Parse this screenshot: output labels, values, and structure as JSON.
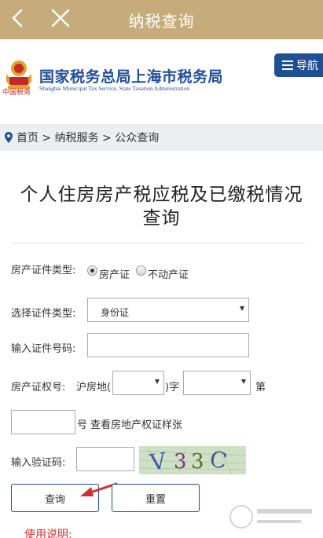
{
  "topbar": {
    "title": "纳税查询",
    "back_icon": "chevron-left-icon",
    "close_icon": "close-icon",
    "background": "#c6ac7a"
  },
  "header": {
    "bureau_name": "国家税务总局上海市税务局",
    "bureau_name_en": "Shanghai Municipal Tax Service, State Taxation Administration",
    "emblem_caption": "中国税务",
    "nav_label": "导航",
    "nav_icon": "menu-icon",
    "brand_color": "#1f4e9c"
  },
  "breadcrumb": {
    "icon": "location-pin-icon",
    "text": "首页 > 纳税服务 > 公众查询"
  },
  "page": {
    "title_line1": "个人住房房产税应税及已缴税情况",
    "title_line2": "查询"
  },
  "form": {
    "cert_type_label": "房产证件类型:",
    "cert_type_options": [
      "房产证",
      "不动产证"
    ],
    "cert_type_selected": "房产证",
    "id_type_label": "选择证件类型:",
    "id_type_value": "身份证",
    "id_number_label": "输入证件号码:",
    "id_number_value": "",
    "deed_label": "房产证权号:",
    "deed_prefix": "沪房地(",
    "deed_middle": ")字",
    "deed_suffix": "第",
    "deed_district_value": "",
    "deed_year_value": "",
    "deed_number_value": "",
    "deed_number_suffix": "号",
    "sample_link": "查看房地产权证样张",
    "captcha_label": "输入验证码:",
    "captcha_value": "",
    "captcha_text": "V33C"
  },
  "buttons": {
    "query": "查询",
    "reset": "重置"
  },
  "footer": {
    "usage_label": "使用说明:"
  },
  "colors": {
    "accent_red": "#d32f2f",
    "button_border": "#1f4f94"
  }
}
